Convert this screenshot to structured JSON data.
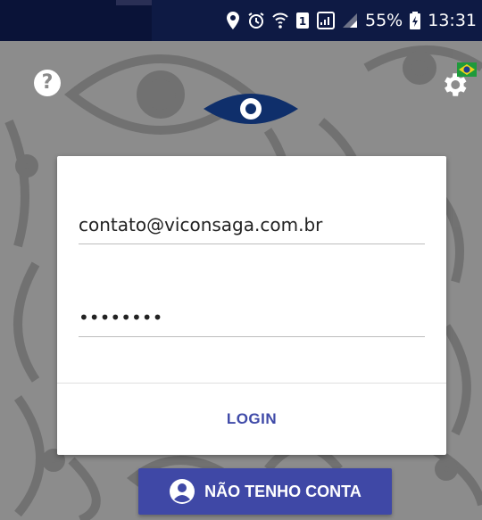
{
  "status_bar": {
    "battery": "55%",
    "time": "13:31"
  },
  "icons": {
    "help": "help-icon",
    "settings": "gear-icon",
    "language": "brazil-flag-icon",
    "logo": "eye-logo-icon",
    "account": "account-circle-icon"
  },
  "help_label": "?",
  "login_form": {
    "email_value": "contato@viconsaga.com.br",
    "password_value": "••••••••",
    "login_label": "LOGIN"
  },
  "no_account_label": "NÃO TENHO CONTA",
  "colors": {
    "status_bar": "#0e1a44",
    "background": "#8c8c8c",
    "accent": "#3f48a6",
    "logo": "#0f2f6b"
  }
}
